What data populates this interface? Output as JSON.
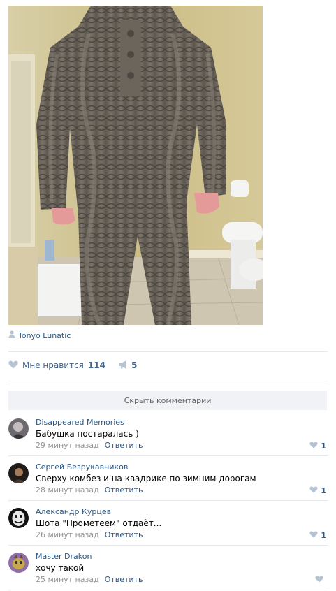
{
  "post": {
    "author": "Tonyo Lunatic",
    "like_label": "Мне нравится",
    "like_count": "114",
    "share_count": "5"
  },
  "comments_toggle": "Скрыть комментарии",
  "comments": [
    {
      "author": "Disappeared Memories",
      "text": "Бабушка постаралась )",
      "time": "29 минут назад",
      "reply": "Ответить",
      "likes": "1"
    },
    {
      "author": "Сергей Безрукавников",
      "text": "Сверху комбез и на квадрике по зимним дорогам",
      "time": "28 минут назад",
      "reply": "Ответить",
      "likes": "1"
    },
    {
      "author": "Александр Курцев",
      "text": "Шота \"Прометеем\" отдаёт...",
      "time": "26 минут назад",
      "reply": "Ответить",
      "likes": "1"
    },
    {
      "author": "Master Drakon",
      "text": "хочу такой",
      "time": "25 минут назад",
      "reply": "Ответить",
      "likes": ""
    }
  ],
  "colors": {
    "link": "#2a5885",
    "muted": "#939393",
    "icon": "#b6c3d3",
    "divider": "#e7e8ec"
  }
}
